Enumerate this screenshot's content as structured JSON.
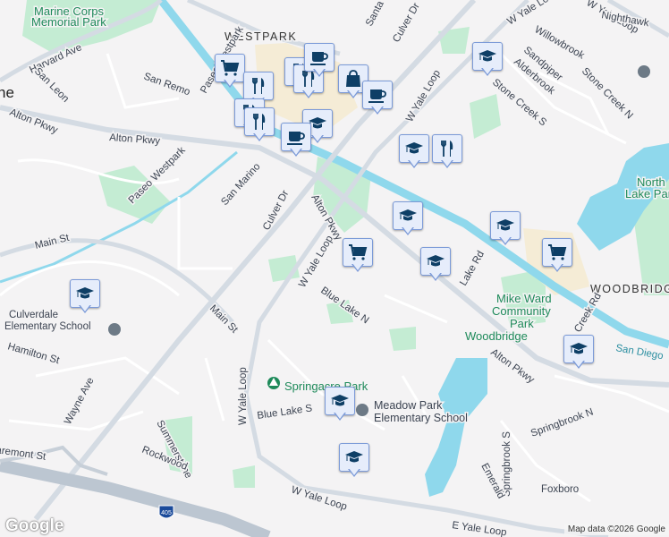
{
  "map": {
    "parks": [
      "Marine Corps",
      "Memorial Park",
      "North",
      "Lake Park",
      "Mike Ward",
      "Community",
      "Park",
      "Woodbridge",
      "Springacre Park"
    ],
    "areas": [
      "WESTPARK",
      "WOODBRIDGE",
      "ne"
    ],
    "schools": [
      "Culverdale",
      "Elementary School",
      "Meadow Park",
      "Elementary School"
    ],
    "streets": [
      "Harvard Ave",
      "San Leon",
      "San Remo",
      "Paseo Westpark",
      "Alton Pkwy",
      "Alton Pkwy",
      "Paseo Westpark",
      "San Marino",
      "Culver Dr",
      "Culver Dr",
      "Alton Pkwy",
      "Main St",
      "Main St",
      "W Yale Loop",
      "W Yale Loop",
      "W Yale Loop",
      "W Yale Loop",
      "Nighthawk",
      "Willowbrook",
      "Sandpiper",
      "Alderbrook",
      "Stone Creek S",
      "Stone Creek N",
      "Blue Lake N",
      "Lake Rd",
      "Creek Rd",
      "Alton Pkwy",
      "Hamilton St",
      "Wayne Ave",
      "aremont St",
      "W Yale Loop",
      "Blue Lake S",
      "Summerstone",
      "Rockwood",
      "Springbrook S",
      "Springbrook N",
      "Emerald",
      "Foxboro",
      "W Yale Loop",
      "E Yale Loop",
      "Santa"
    ],
    "water": [
      "San Diego"
    ],
    "highway_shield": "405",
    "colors": {
      "park": "#c4ecd3",
      "water": "#8fd8ec",
      "road": "#d4dbe3",
      "commercial": "#f5ecd6",
      "marker_bg": "#e6edfb",
      "marker_icon": "#0e3f66"
    }
  },
  "markers": [
    {
      "icon": "shopping-cart-icon"
    },
    {
      "icon": "restaurant-icon"
    },
    {
      "icon": "restaurant-icon"
    },
    {
      "icon": "restaurant-icon"
    },
    {
      "icon": "coffee-icon"
    },
    {
      "icon": "shopping-bag-icon"
    },
    {
      "icon": "coffee-icon"
    },
    {
      "icon": "restaurant-icon"
    },
    {
      "icon": "restaurant-icon"
    },
    {
      "icon": "graduation-cap-icon"
    },
    {
      "icon": "coffee-icon"
    },
    {
      "icon": "graduation-cap-icon"
    },
    {
      "icon": "graduation-cap-icon"
    },
    {
      "icon": "restaurant-icon"
    },
    {
      "icon": "graduation-cap-icon"
    },
    {
      "icon": "shopping-cart-icon"
    },
    {
      "icon": "graduation-cap-icon"
    },
    {
      "icon": "graduation-cap-icon"
    },
    {
      "icon": "shopping-cart-icon"
    },
    {
      "icon": "graduation-cap-icon"
    },
    {
      "icon": "graduation-cap-icon"
    },
    {
      "icon": "graduation-cap-icon"
    },
    {
      "icon": "graduation-cap-icon"
    }
  ],
  "footer": {
    "logo": "Google",
    "attribution": "Map data ©2026 Google"
  }
}
